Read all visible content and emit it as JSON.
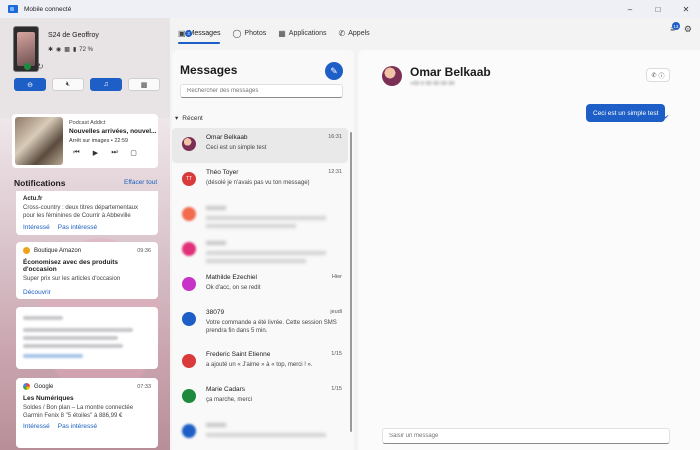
{
  "window": {
    "title": "Mobile connecté"
  },
  "phone": {
    "name": "S24 de Geoffroy",
    "battery": "72 %"
  },
  "media": {
    "app": "Podcast Addict",
    "title": "Nouvelles arrivées, nouvel...",
    "subtitle": "Arrêt sur images • 22:59"
  },
  "notifications": {
    "header": "Notifications",
    "clear_label": "Effacer tout",
    "items": [
      {
        "app": "Actu.fr",
        "body": "Cross-country : deux titres départementaux pour les féminines de Courrir à Abbeville",
        "actions": [
          "Intéressé",
          "Pas intéressé"
        ]
      },
      {
        "app": "Boutique Amazon",
        "time": "09:36",
        "title": "Économisez avec des produits d'occasion",
        "body": "Super prix sur les articles d'occasion",
        "actions": [
          "Découvrir"
        ]
      },
      {
        "app": "Google",
        "time": "07:33",
        "title": "Les Numériques",
        "body": "Soldes / Bon plan – La montre connectée Garmin Fenix 8 \"5 étoiles\" à 886,99 €",
        "actions": [
          "Intéressé",
          "Pas intéressé"
        ]
      }
    ]
  },
  "nav": {
    "tabs": [
      "Messages",
      "Photos",
      "Applications",
      "Appels"
    ],
    "messages_badge": "3",
    "notif_badge": "13"
  },
  "messages": {
    "heading": "Messages",
    "search_placeholder": "Rechercher des messages",
    "section": "Récent",
    "conversations": [
      {
        "name": "Omar Belkaab",
        "time": "16:31",
        "preview": "Ceci est un simple test",
        "color": "#7b2f55",
        "initials": ""
      },
      {
        "name": "Théo Toyer",
        "time": "12:31",
        "preview": "(désolé je n'avais pas vu ton message)",
        "color": "#d93a3a",
        "initials": "TT"
      },
      {
        "name": "Mathilde Ezechiel",
        "time": "Hier",
        "preview": "Ok d'acc, on se redit",
        "color": "#c633c6",
        "initials": ""
      },
      {
        "name": "38079",
        "time": "jeudi",
        "preview": "Votre commande a été livrée. Cette session SMS prendra fin dans 5 min.",
        "color": "#1d5fc6",
        "initials": ""
      },
      {
        "name": "Frederic Saint Etienne",
        "time": "1/15",
        "preview": "a ajouté un « J'aime » à « top, merci ! ».",
        "color": "#d93a3a",
        "initials": ""
      },
      {
        "name": "Marie Cadars",
        "time": "1/15",
        "preview": "ça marche, merci",
        "color": "#1e8a3e",
        "initials": ""
      }
    ]
  },
  "chat": {
    "contact": "Omar Belkaab",
    "sent_message": "Ceci est un simple test",
    "reply_placeholder": "Saisir un message"
  }
}
